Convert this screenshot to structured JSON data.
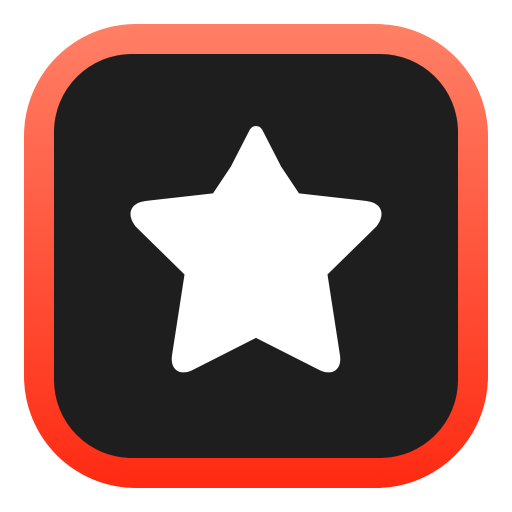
{
  "app_icon": {
    "icon": "star-icon",
    "colors": {
      "frame_top": "#FF8066",
      "frame_bottom": "#FF2A12",
      "tile": "#1E1E1E",
      "star": "#FFFFFF",
      "background": "#FFFFFF"
    }
  }
}
